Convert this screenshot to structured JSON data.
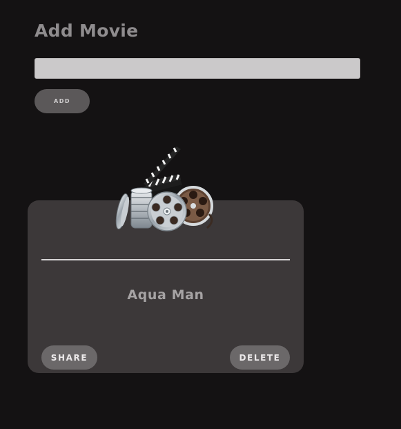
{
  "header": {
    "title": "Add Movie"
  },
  "form": {
    "input_value": "",
    "add_label": "ADD"
  },
  "movies": [
    {
      "title": "Aqua Man",
      "share_label": "SHARE",
      "delete_label": "DELETE",
      "image_icon": "film-reels-clapperboard-icon"
    }
  ]
}
